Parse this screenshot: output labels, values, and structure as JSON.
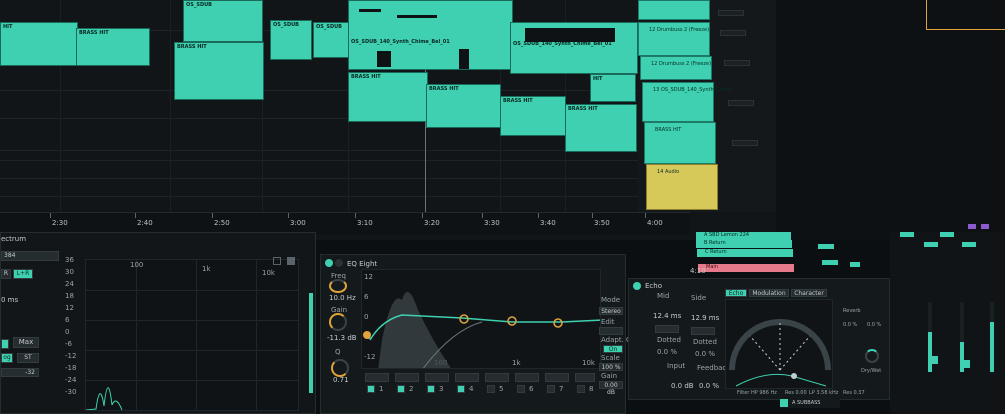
{
  "arrangement": {
    "clip_labels": {
      "hit_1": "HIT",
      "brass_hit_1": "BRASS HIT",
      "os_sdub_1": "OS_SDUB",
      "brass_hit_2": "BRASS HIT",
      "os_sdub_2": "OS_SDUB",
      "os_sdub_3": "OS_SDUB",
      "sdub_synth": "OS_SDUB_140_Synth_Chime_Bel_01",
      "brass_hit_3": "BRASS HIT",
      "brass_hit_4": "BRASS HIT",
      "brass_hit_5": "BRASS HIT",
      "brass_hit_6": "BRASS HIT",
      "hit_2": "HIT"
    },
    "timeline": [
      "2:30",
      "2:40",
      "2:50",
      "3:00",
      "3:10",
      "3:20",
      "3:30",
      "3:40",
      "3:50",
      "4:00"
    ],
    "track_headers": [
      {
        "name": "12 Drumbuss 2 (Freeze)",
        "color": "#3ed0b0"
      },
      {
        "name": "13 OS_SDUB_140_Synth_Chime",
        "color": "#3ed0b0"
      },
      {
        "name": "BRASS HIT",
        "color": "#3ed0b0"
      },
      {
        "name": "14 Audio",
        "color": "#d6c95a"
      }
    ],
    "return_tracks": [
      "A SBD Lemon 224",
      "B Return",
      "C Return",
      "Main"
    ],
    "loop_position": "4:10"
  },
  "spectrum": {
    "title": "ectrum",
    "block": "384",
    "channel": "L+R",
    "r_label": "R",
    "time": "0 ms",
    "max_label": "Max",
    "log_label": "og",
    "st_label": "ST",
    "range_value": "-32",
    "db_scale": [
      "36",
      "30",
      "24",
      "18",
      "12",
      "6",
      "0",
      "-6",
      "-12",
      "-18",
      "-24",
      "-30"
    ],
    "freq_labels": [
      "100",
      "1k",
      "10k"
    ]
  },
  "eq": {
    "title": "EQ Eight",
    "freq_label": "Freq",
    "freq_value": "10.0 Hz",
    "gain_label": "Gain",
    "gain_value": "-11.3 dB",
    "q_label": "Q",
    "q_value": "0.71",
    "db_scale": [
      "12",
      "6",
      "0",
      "-6",
      "-12"
    ],
    "freq_labels": [
      "100",
      "1k",
      "10k"
    ],
    "mode_label": "Mode",
    "mode_value": "Stereo",
    "edit_label": "Edit",
    "adapt_label": "Adapt. Q",
    "adapt_value": "On",
    "scale_label": "Scale",
    "scale_value": "100 %",
    "out_gain_label": "Gain",
    "out_gain_value": "0.00 dB",
    "bands": [
      "1",
      "2",
      "3",
      "4",
      "5",
      "6",
      "7",
      "8"
    ]
  },
  "echo": {
    "title": "Echo",
    "tabs": [
      "Echo",
      "Modulation",
      "Character"
    ],
    "mid_label": "Mid",
    "side_label": "Side",
    "delay_left": "12.4 ms",
    "delay_right": "12.9 ms",
    "sync_label": "Dotted",
    "offset_left": "0.0 %",
    "offset_right": "0.0 %",
    "input_label": "Input",
    "feedback_label": "Feedback",
    "input_value": "0.0 dB",
    "feedback_value": "0.0 %",
    "filter_label": "Filter HP 986 Hz",
    "res1_label": "Res 0.00",
    "lp_label": "LP 3.58 kHz",
    "res2_label": "Res 0.37",
    "reverb_label": "Reverb",
    "dry_wet_label": "Dry/Wet",
    "reverb_values": [
      "0.0 %",
      "0.0 %"
    ]
  },
  "mixer": {
    "bottom_track": "A SUBBASS"
  },
  "colors": {
    "accent": "#3ed0b0",
    "yellow": "#d6c95a",
    "orange": "#e0a43a",
    "red": "#e05060",
    "pink": "#e77a8a",
    "purple": "#8a5ad0"
  }
}
